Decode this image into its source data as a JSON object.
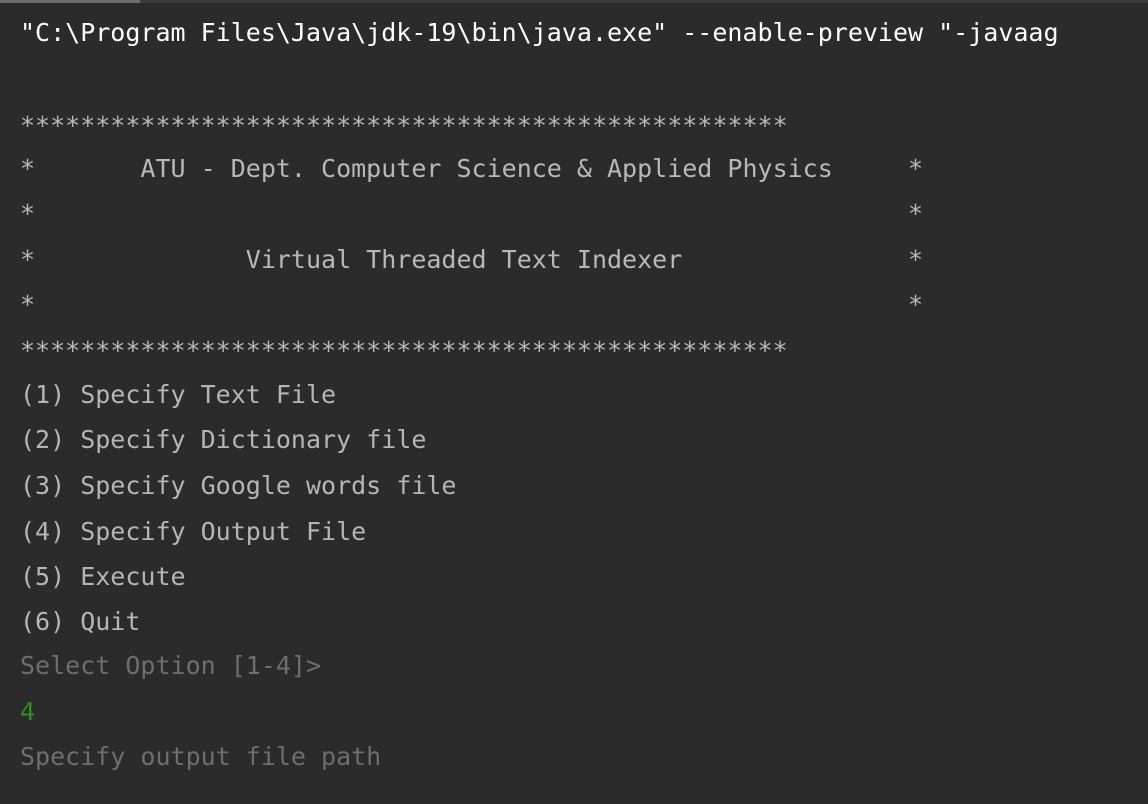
{
  "command": "\"C:\\Program Files\\Java\\jdk-19\\bin\\java.exe\" --enable-preview \"-javaag",
  "banner": {
    "border_top": "***************************************************",
    "line_org": "*       ATU - Dept. Computer Science & Applied Physics     *",
    "line_blank_1": "*                                                          *",
    "line_title": "*              Virtual Threaded Text Indexer               *",
    "line_blank_2": "*                                                          *",
    "border_bottom": "***************************************************"
  },
  "menu": {
    "items": [
      "(1) Specify Text File",
      "(2) Specify Dictionary file",
      "(3) Specify Google words file",
      "(4) Specify Output File",
      "(5) Execute",
      "(6) Quit"
    ]
  },
  "prompt": "Select Option [1-4]>",
  "user_input": "4",
  "follow_up": "Specify output file path",
  "colors": {
    "background": "#2b2b2b",
    "command_text": "#ffffff",
    "banner_text": "#b8b8b8",
    "menu_text": "#b5b5b5",
    "prompt_text": "#6e6e6e",
    "input_text": "#2f8f1e"
  }
}
